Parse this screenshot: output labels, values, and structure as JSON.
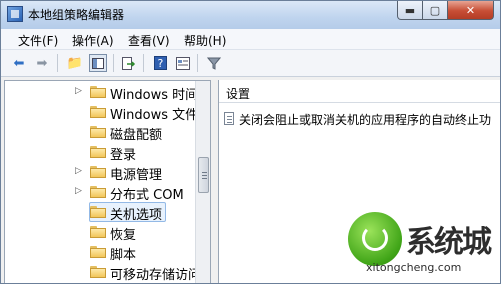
{
  "window": {
    "title": "本地组策略编辑器"
  },
  "menubar": {
    "items": [
      "文件(F)",
      "操作(A)",
      "查看(V)",
      "帮助(H)"
    ]
  },
  "toolbar": {
    "buttons": [
      "back-icon",
      "forward-icon",
      "up-folder-icon",
      "show-hide-tree-icon",
      "export-list-icon",
      "help-icon",
      "properties-icon",
      "filter-icon"
    ]
  },
  "tree": {
    "items": [
      {
        "label": "Windows 时间服",
        "arrow": "▷"
      },
      {
        "label": "Windows 文件保",
        "arrow": ""
      },
      {
        "label": "磁盘配额",
        "arrow": ""
      },
      {
        "label": "登录",
        "arrow": ""
      },
      {
        "label": "电源管理",
        "arrow": "▷"
      },
      {
        "label": "分布式 COM",
        "arrow": "▷"
      },
      {
        "label": "关机选项",
        "arrow": ""
      },
      {
        "label": "恢复",
        "arrow": ""
      },
      {
        "label": "脚本",
        "arrow": ""
      },
      {
        "label": "可移动存储访问",
        "arrow": ""
      }
    ],
    "selected_index": 6
  },
  "details": {
    "column_header": "设置",
    "settings": [
      "关闭会阻止或取消关机的应用程序的自动终止功"
    ]
  },
  "watermark": {
    "text": "系统城",
    "url": "xitongcheng.com"
  }
}
